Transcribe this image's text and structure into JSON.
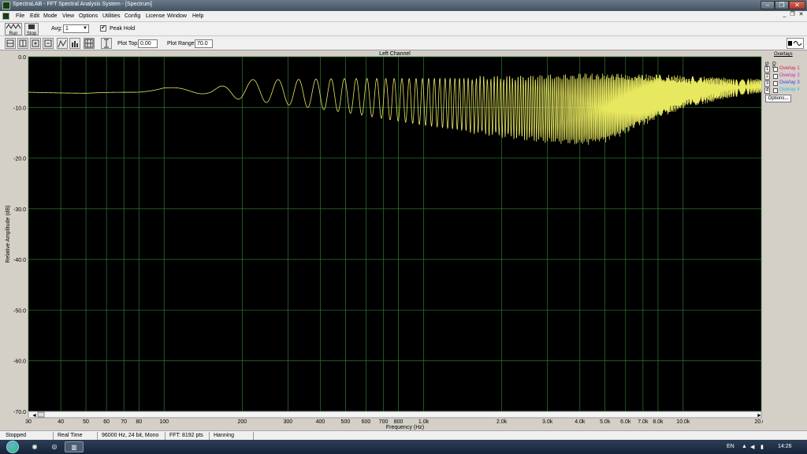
{
  "window": {
    "title": "SpectraLAB - FFT Spectral Analysis System - [Spectrum]",
    "minimize_glyph": "–",
    "restore_glyph": "❐",
    "close_glyph": "✕"
  },
  "menubar": {
    "items": [
      "File",
      "Edit",
      "Mode",
      "View",
      "Options",
      "Utilities",
      "Config",
      "License",
      "Window",
      "Help"
    ],
    "mdi_minimize": "_",
    "mdi_restore": "❐",
    "mdi_close": "✕"
  },
  "toolbar1": {
    "run_label": "Run",
    "stop_label": "Stop",
    "avg_label": "Avg:",
    "avg_value": "1",
    "peak_hold_label": "Peak Hold",
    "peak_hold_checked": "✔"
  },
  "toolbar2": {
    "plot_top_label": "Plot Top:",
    "plot_top_value": "0.00",
    "plot_range_label": "Plot Range:",
    "plot_range_value": "70.0"
  },
  "overlays": {
    "header": "Overlays",
    "set_label": "Set",
    "on_label": "On",
    "items": [
      {
        "num": "1",
        "name": "Overlay 1",
        "color": "#e0204a"
      },
      {
        "num": "2",
        "name": "Overlay 2",
        "color": "#d020c0"
      },
      {
        "num": "3",
        "name": "Overlay 3",
        "color": "#4040e0"
      },
      {
        "num": "4",
        "name": "Overlay 4",
        "color": "#20c0e0"
      }
    ],
    "options_label": "Options..."
  },
  "chart_data": {
    "type": "line",
    "title": "Left Channel",
    "xlabel": "Frequency (Hz)",
    "ylabel": "Relative Amplitude (dB)",
    "x_scale": "log",
    "xlim": [
      30,
      20000
    ],
    "ylim": [
      -70,
      0
    ],
    "yticks": [
      0,
      -10,
      -20,
      -30,
      -40,
      -50,
      -60,
      -70
    ],
    "ytick_labels": [
      "0.0",
      "-10.0",
      "-20.0",
      "-30.0",
      "-40.0",
      "-50.0",
      "-60.0",
      "-70.0"
    ],
    "xticks": [
      30,
      40,
      50,
      60,
      70,
      80,
      100,
      200,
      300,
      400,
      500,
      600,
      700,
      800,
      1000,
      2000,
      3000,
      4000,
      5000,
      6000,
      7000,
      8000,
      10000,
      20000
    ],
    "xtick_labels": [
      "30",
      "40",
      "50",
      "60",
      "70",
      "80",
      "100",
      "200",
      "300",
      "400",
      "500",
      "600",
      "700",
      "800",
      "1.0k",
      "2.0k",
      "3.0k",
      "4.0k",
      "5.0k",
      "6.0k",
      "7.0k",
      "8.0k",
      "10.0k",
      "20.0k"
    ],
    "background": "#000000",
    "grid_color": "#2f7a2f",
    "line_color": "#e8e860",
    "grid": true,
    "series": [
      {
        "values_description_free": true,
        "envelope": {
          "x": [
            30,
            50,
            80,
            100,
            150,
            200,
            300,
            500,
            1000,
            2000,
            3000,
            4000,
            5000,
            8000,
            10000,
            15000,
            20000
          ],
          "upper": [
            -7.0,
            -7.2,
            -6.8,
            -6.0,
            -6.5,
            -4.5,
            -4.5,
            -4.3,
            -4.3,
            -4.2,
            -4.0,
            -3.8,
            -3.8,
            -3.8,
            -4.0,
            -4.3,
            -4.5
          ],
          "lower": [
            -7.0,
            -7.3,
            -7.0,
            -6.5,
            -7.5,
            -8.5,
            -9.5,
            -11.0,
            -13.5,
            -15.5,
            -16.5,
            -17.0,
            -16.5,
            -12.0,
            -10.0,
            -8.0,
            -7.0
          ]
        }
      }
    ]
  },
  "statusbar": {
    "state": "Stopped",
    "mode": "Real Time",
    "format": "96000 Hz, 24 bit, Mono",
    "fft": "FFT: 8192 pts",
    "window": "Hanning"
  },
  "taskbar": {
    "lang": "EN",
    "time": "14:26"
  }
}
